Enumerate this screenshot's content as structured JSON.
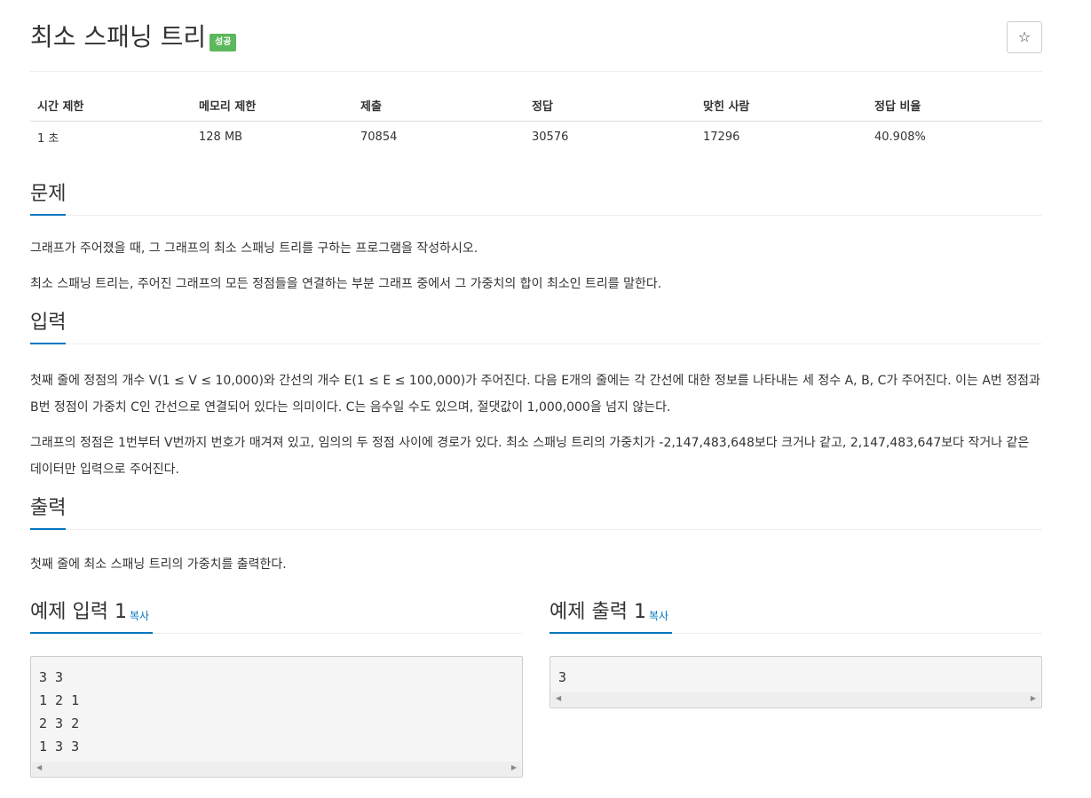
{
  "problem": {
    "title": "최소 스패닝 트리",
    "badge": "성공",
    "star": "☆"
  },
  "info_table": {
    "headers": [
      "시간 제한",
      "메모리 제한",
      "제출",
      "정답",
      "맞힌 사람",
      "정답 비율"
    ],
    "values": [
      "1 초",
      "128 MB",
      "70854",
      "30576",
      "17296",
      "40.908%"
    ]
  },
  "sections": {
    "description": {
      "heading": "문제",
      "paragraphs": [
        "그래프가 주어졌을 때, 그 그래프의 최소 스패닝 트리를 구하는 프로그램을 작성하시오.",
        "최소 스패닝 트리는, 주어진 그래프의 모든 정점들을 연결하는 부분 그래프 중에서 그 가중치의 합이 최소인 트리를 말한다."
      ]
    },
    "input": {
      "heading": "입력",
      "paragraphs": [
        "첫째 줄에 정점의 개수 V(1 ≤ V ≤ 10,000)와 간선의 개수 E(1 ≤ E ≤ 100,000)가 주어진다. 다음 E개의 줄에는 각 간선에 대한 정보를 나타내는 세 정수 A, B, C가 주어진다. 이는 A번 정점과 B번 정점이 가중치 C인 간선으로 연결되어 있다는 의미이다. C는 음수일 수도 있으며, 절댓값이 1,000,000을 넘지 않는다.",
        "그래프의 정점은 1번부터 V번까지 번호가 매겨져 있고, 임의의 두 정점 사이에 경로가 있다. 최소 스패닝 트리의 가중치가 -2,147,483,648보다 크거나 같고, 2,147,483,647보다 작거나 같은 데이터만 입력으로 주어진다."
      ]
    },
    "output": {
      "heading": "출력",
      "paragraphs": [
        "첫째 줄에 최소 스패닝 트리의 가중치를 출력한다."
      ]
    }
  },
  "examples": {
    "input": {
      "heading": "예제 입력 1",
      "copy_label": "복사",
      "content": "3 3\n1 2 1\n2 3 2\n1 3 3"
    },
    "output": {
      "heading": "예제 출력 1",
      "copy_label": "복사",
      "content": "3"
    }
  },
  "colors": {
    "accent": "#0076c0",
    "success_badge": "#5cb85c"
  }
}
